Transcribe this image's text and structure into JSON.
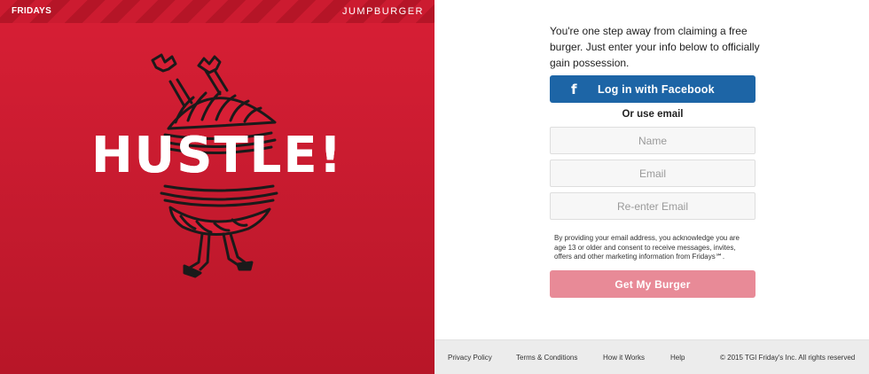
{
  "brand": {
    "fridays_logo": "FRIDAYS",
    "campaign_logo": "JUMPBURGER"
  },
  "hero": {
    "headline": "HUSTLE!",
    "illustration": "burger-character-icon"
  },
  "signup": {
    "intro": "You're one step away from claiming a free burger. Just enter your info below to officially gain possession.",
    "facebook_icon": "f",
    "facebook_label": "Log in with Facebook",
    "or_email": "Or use email",
    "name_placeholder": "Name",
    "email_placeholder": "Email",
    "reenter_email_placeholder": "Re-enter Email",
    "disclaimer": "By providing your email address, you acknowledge you are age 13 or older and consent to receive messages, invites, offers and other marketing information from Fridays℠.",
    "submit_label": "Get My Burger"
  },
  "footer": {
    "privacy": "Privacy Policy",
    "terms": "Terms & Conditions",
    "how": "How it Works",
    "help": "Help",
    "copyright": "© 2015 TGI Friday's Inc. All rights reserved"
  },
  "colors": {
    "brand_red": "#d81f35",
    "facebook_blue": "#1d65a6",
    "submit_pink": "#e88a97",
    "footer_bg": "#ececec"
  }
}
